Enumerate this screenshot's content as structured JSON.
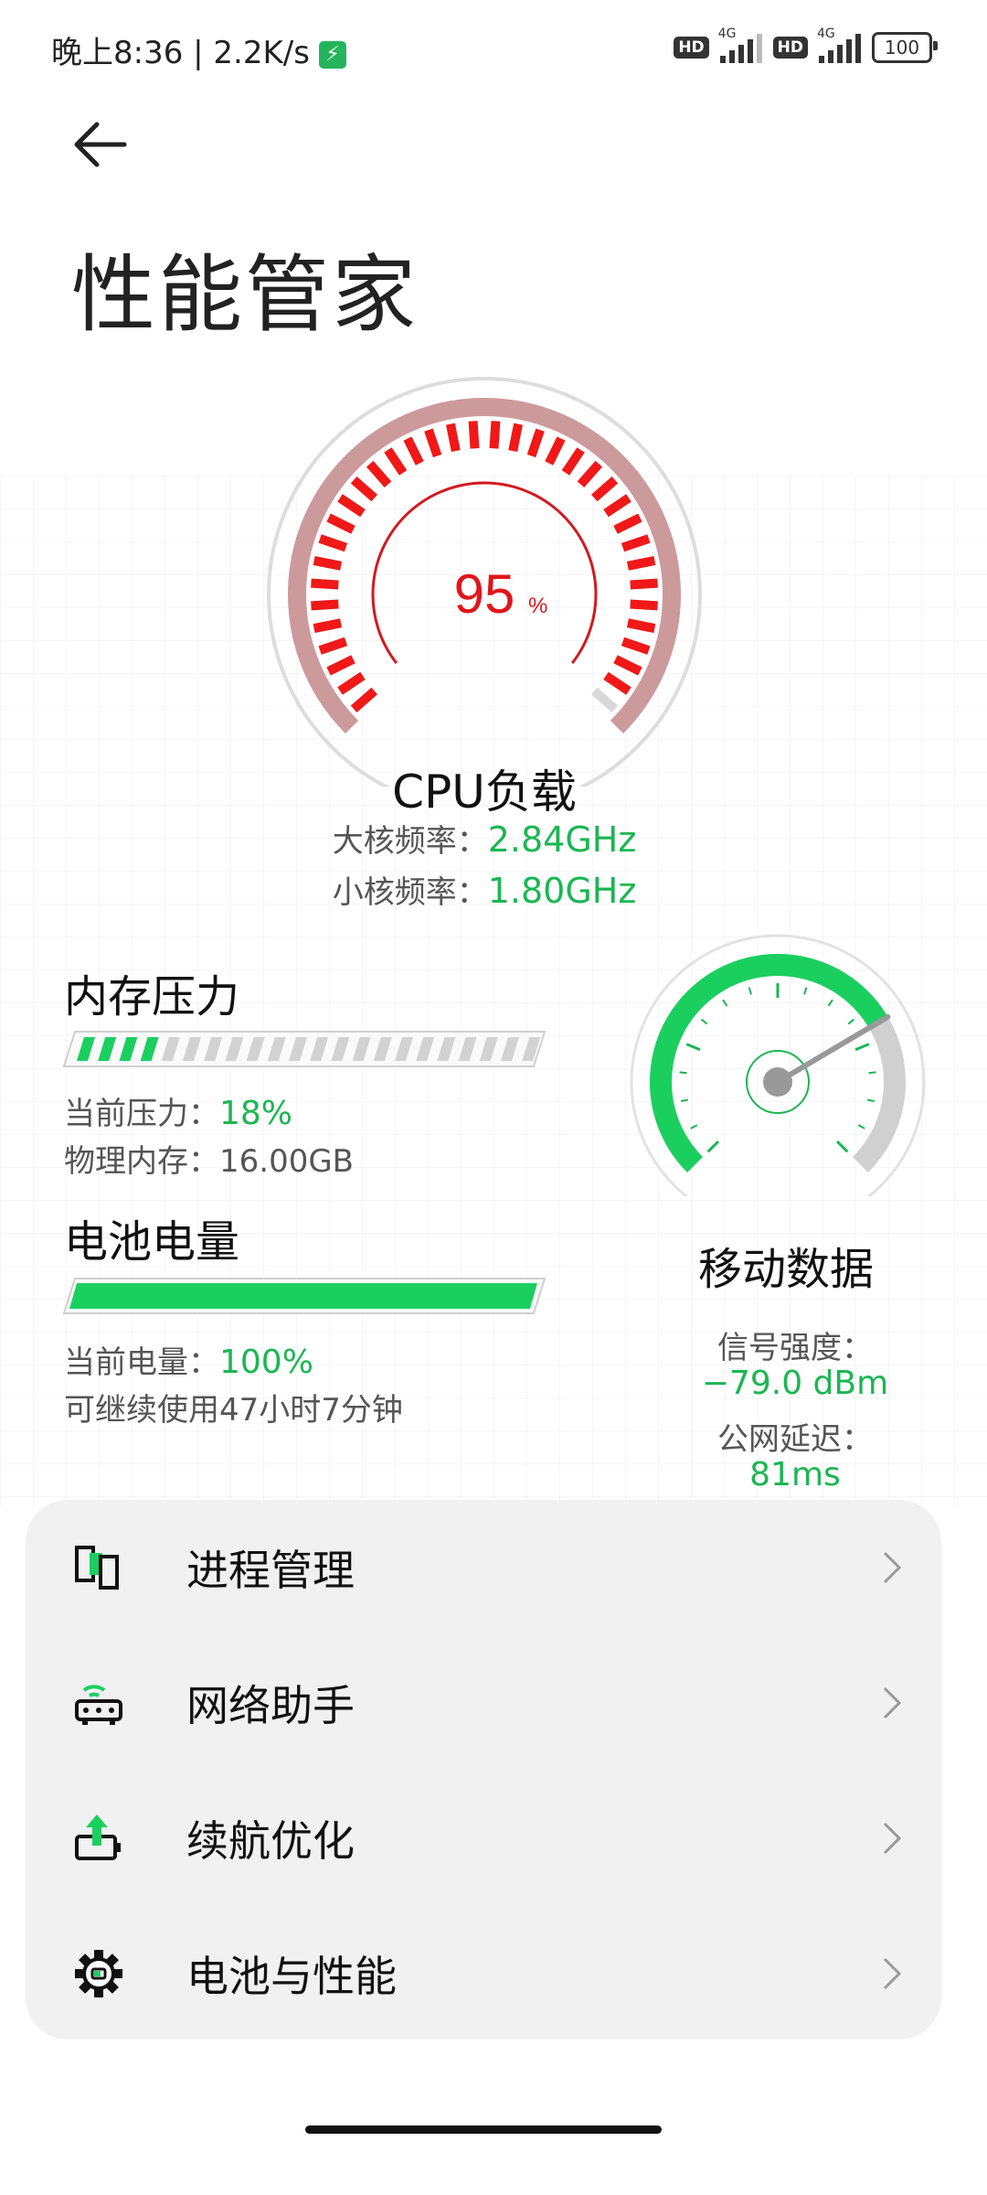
{
  "status_bar": {
    "time": "晚上8:36 | 2.2K/s",
    "hd1": "HD",
    "net1": "4G",
    "hd2": "HD",
    "net2": "4G",
    "battery": "100",
    "charging_icon": "bolt-icon"
  },
  "header": {
    "back_icon": "back-arrow-icon",
    "title": "性能管家"
  },
  "cpu": {
    "percent": "95",
    "unit": "%",
    "load_fraction": 0.95,
    "title": "CPU负载",
    "big_core_label": "大核频率：",
    "big_core_value": "2.84GHz",
    "small_core_label": "小核频率：",
    "small_core_value": "1.80GHz"
  },
  "memory": {
    "title": "内存压力",
    "pressure_label": "当前压力：",
    "pressure_value": "18%",
    "pressure_fraction": 0.18,
    "physical_label": "物理内存：",
    "physical_value": "16.00GB"
  },
  "battery": {
    "title": "电池电量",
    "level_label": "当前电量：",
    "level_value": "100%",
    "level_fraction": 1.0,
    "remaining": "可继续使用47小时7分钟"
  },
  "mobile_data": {
    "title": "移动数据",
    "signal_label": "信号强度：",
    "signal_value": "−79.0 dBm",
    "latency_label": "公网延迟：",
    "latency_value": "81ms",
    "signal_fraction": 0.72
  },
  "menu": {
    "items": [
      {
        "label": "进程管理",
        "icon": "process-icon"
      },
      {
        "label": "网络助手",
        "icon": "router-icon"
      },
      {
        "label": "续航优化",
        "icon": "battery-boost-icon"
      },
      {
        "label": "电池与性能",
        "icon": "gear-icon"
      }
    ]
  },
  "colors": {
    "accent_green": "#1bb653",
    "cpu_red": "#e0151c"
  }
}
